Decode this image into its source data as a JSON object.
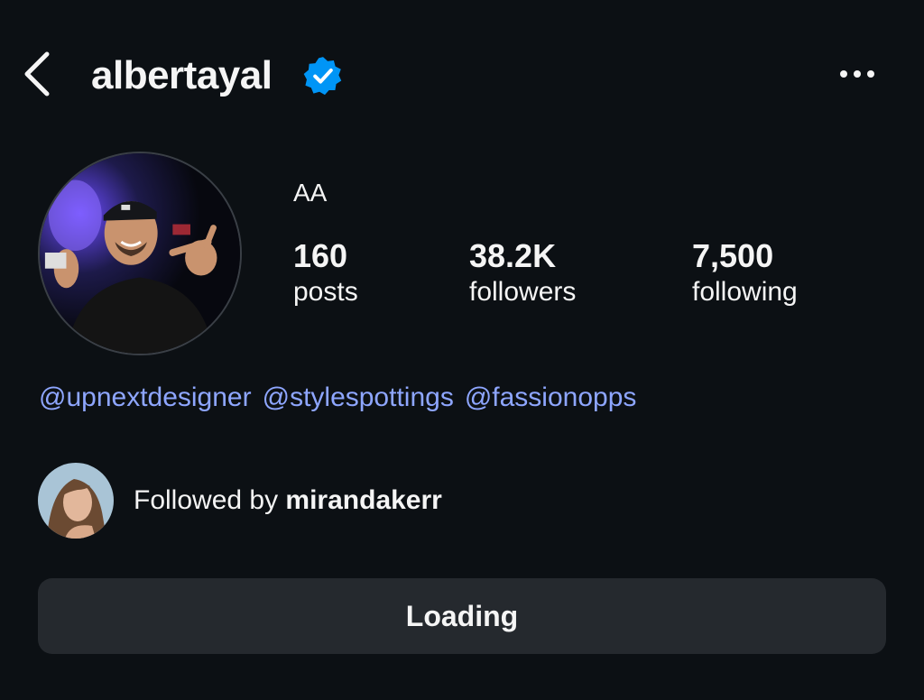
{
  "header": {
    "back_icon": "chevron-left-icon",
    "username": "albertayal",
    "verified_icon": "verified-badge-icon",
    "more_icon": "more-horizontal-icon"
  },
  "profile": {
    "display_name": "AA",
    "stats": [
      {
        "value": "160",
        "label": "posts"
      },
      {
        "value": "38.2K",
        "label": "followers"
      },
      {
        "value": "7,500",
        "label": "following"
      }
    ],
    "bio_links": [
      "@upnextdesigner",
      "@stylespottings",
      "@fassionopps"
    ],
    "followed_by_prefix": "Followed by",
    "followed_by_user": "mirandakerr"
  },
  "action_button": {
    "label": "Loading"
  },
  "colors": {
    "background": "#0c1014",
    "link": "#8ea6ff",
    "verified": "#0095f6",
    "button_bg": "#25292e"
  }
}
